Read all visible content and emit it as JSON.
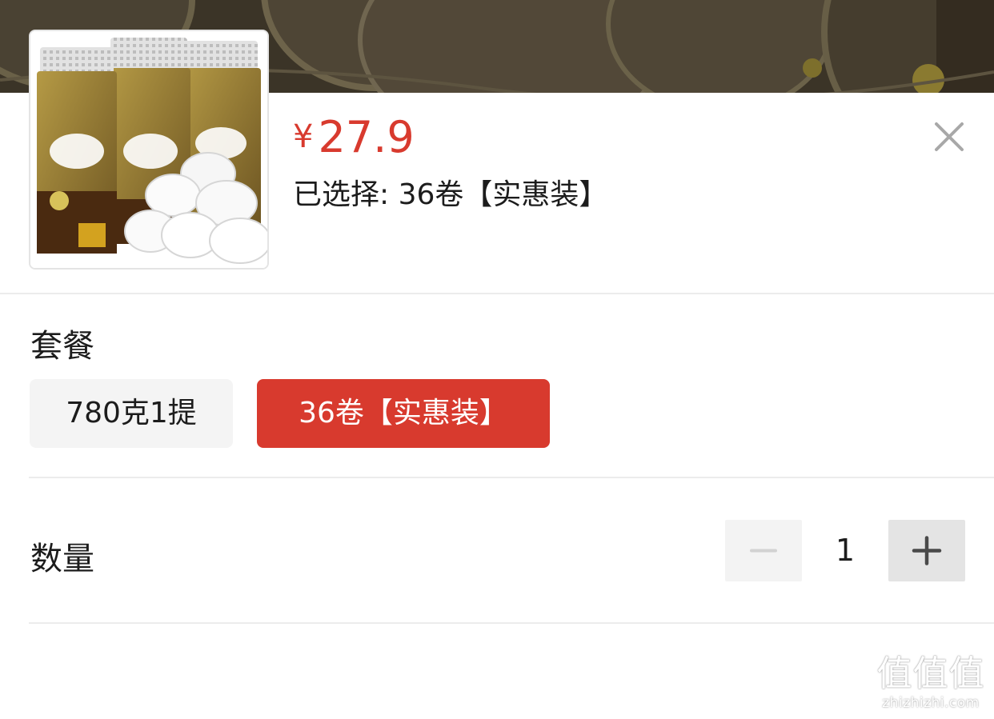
{
  "product": {
    "image_icon": "toilet-paper-product-image",
    "price_currency": "¥",
    "price_amount": "27.9",
    "selected_text": "已选择: 36卷【实惠装】"
  },
  "close_icon": "close-icon",
  "package_section": {
    "title": "套餐",
    "options": [
      {
        "label": "780克1提",
        "selected": false
      },
      {
        "label": "36卷【实惠装】",
        "selected": true
      }
    ]
  },
  "quantity_section": {
    "title": "数量",
    "value": "1",
    "decrement_icon": "minus-icon",
    "increment_icon": "plus-icon",
    "decrement_enabled": false
  },
  "watermark": {
    "site": "zhizhizhi.com"
  },
  "colors": {
    "accent": "#d83a2e",
    "backdrop": "#3b3427",
    "option_bg": "#f4f4f4",
    "divider": "#ececec"
  }
}
